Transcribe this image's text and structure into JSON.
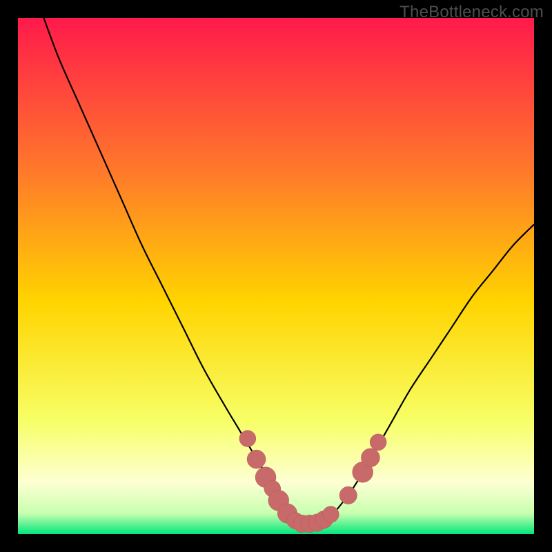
{
  "watermark": "TheBottleneck.com",
  "colors": {
    "bg_black": "#000000",
    "curve": "#000000",
    "marker_fill": "#c96a6a",
    "marker_stroke": "#b35757",
    "grad_top": "#ff1a4b",
    "grad_upper_mid": "#ff7a2a",
    "grad_mid": "#ffd400",
    "grad_lower_mid": "#f7ff66",
    "grad_pale": "#fdffd2",
    "grad_green": "#00e67a"
  },
  "chart_data": {
    "type": "line",
    "title": "",
    "xlabel": "",
    "ylabel": "",
    "xlim": [
      0,
      100
    ],
    "ylim": [
      0,
      100
    ],
    "series": [
      {
        "name": "bottleneck-curve",
        "x": [
          5,
          8,
          12,
          16,
          20,
          24,
          28,
          32,
          36,
          40,
          43,
          46,
          49,
          52,
          54,
          56,
          58,
          60,
          62,
          65,
          68,
          72,
          76,
          80,
          84,
          88,
          92,
          96,
          100
        ],
        "y": [
          100,
          92,
          83,
          74,
          65,
          56,
          48,
          40,
          32,
          25,
          20,
          15,
          10,
          5,
          3,
          2,
          2,
          3,
          5,
          9,
          14,
          21,
          28,
          34,
          40,
          46,
          51,
          56,
          60
        ]
      }
    ],
    "markers": [
      {
        "x": 44.5,
        "y": 18.5,
        "r": 1.6
      },
      {
        "x": 46.2,
        "y": 14.5,
        "r": 1.8
      },
      {
        "x": 48.0,
        "y": 11.0,
        "r": 2.0
      },
      {
        "x": 49.3,
        "y": 8.8,
        "r": 1.6
      },
      {
        "x": 50.5,
        "y": 6.5,
        "r": 2.0
      },
      {
        "x": 52.2,
        "y": 4.0,
        "r": 1.9
      },
      {
        "x": 53.7,
        "y": 2.6,
        "r": 1.6
      },
      {
        "x": 55.0,
        "y": 2.0,
        "r": 1.7
      },
      {
        "x": 56.5,
        "y": 2.0,
        "r": 1.7
      },
      {
        "x": 58.0,
        "y": 2.2,
        "r": 1.7
      },
      {
        "x": 59.3,
        "y": 2.8,
        "r": 1.7
      },
      {
        "x": 60.6,
        "y": 3.8,
        "r": 1.6
      },
      {
        "x": 64.0,
        "y": 7.5,
        "r": 1.7
      },
      {
        "x": 66.8,
        "y": 12.0,
        "r": 2.0
      },
      {
        "x": 68.3,
        "y": 14.8,
        "r": 1.8
      },
      {
        "x": 69.8,
        "y": 17.8,
        "r": 1.6
      }
    ]
  }
}
